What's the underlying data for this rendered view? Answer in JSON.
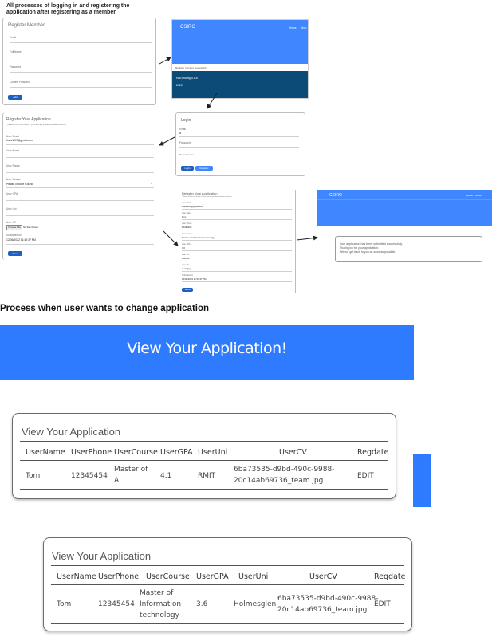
{
  "top_caption": [
    "All processes of logging in and registering the",
    "application after registering as a member"
  ],
  "section_title": "Process when user wants to change application",
  "register_member": {
    "title": "Register Member",
    "fields": [
      "Email",
      "Full Name",
      "Password",
      "Confirm Password"
    ],
    "button": "Add"
  },
  "csiro_home": {
    "brand": "CSIRO",
    "nav": [
      "Home",
      "Abou"
    ],
    "message": "Register member successful!",
    "footer_name": "Hao Hoang D11K",
    "footer_year": "2022"
  },
  "login": {
    "title": "Login",
    "email_label": "Email",
    "email_value": "a",
    "password_label": "Password",
    "remember": "Remember me",
    "login_button": "Login",
    "register_button": "Register"
  },
  "register_application_empty": {
    "title": "Register Your Application",
    "subtitle": "* please fill the form below, if you have any problems please contact us",
    "email_label": "User Email",
    "email_value": "thanhk99@gmail.com",
    "fields": [
      "User Name",
      "User Phone",
      "User Course",
      "User GPA",
      "User Uni",
      "User CV"
    ],
    "course_value": "Please choose Course",
    "file_button": "Choose File",
    "file_text": "No file chosen",
    "date_label": "Submitted on",
    "date_value": "12/06/2022 11:40:37 PM",
    "button": "Send"
  },
  "register_application_filled": {
    "title": "Register Your Application",
    "subtitle": "* please fill the form below, if you have any problems please contact us",
    "fields": [
      {
        "label": "User Email",
        "value": "thanhk99@gmail.com"
      },
      {
        "label": "User Name",
        "value": "Tom"
      },
      {
        "label": "User Phone",
        "value": "12345454"
      },
      {
        "label": "User Course",
        "value": "Master of Information technology"
      },
      {
        "label": "User GPA",
        "value": "3.6"
      },
      {
        "label": "User Uni",
        "value": "Holmes"
      },
      {
        "label": "User CV",
        "value": "team.jpg"
      },
      {
        "label": "Submitted on",
        "value": "12/06/2022 11:54:37 PM"
      }
    ],
    "file_button": "Choose File",
    "button": "Send"
  },
  "csiro_submitted": {
    "brand": "CSIRO",
    "nav": [
      "Home",
      "About"
    ],
    "lines": [
      "Your application has been submitted successfully.",
      "Thank you for your application.",
      "We will get back to you as soon as possible."
    ]
  },
  "view_banner": "View Your Application!",
  "table_one": {
    "title": "View Your Application",
    "headers": [
      "UserName",
      "UserPhone",
      "UserCourse",
      "UserGPA",
      "UserUni",
      "UserCV",
      "Regdate"
    ],
    "row": {
      "name": "Tom",
      "phone": "12345454",
      "course": [
        "Master of",
        "AI"
      ],
      "gpa": "4.1",
      "uni": "RMIT",
      "cv": [
        "6ba73535-d9bd-490c-9988-",
        "20c14ab69736_team.jpg"
      ],
      "action": "EDIT"
    }
  },
  "table_two": {
    "title": "View Your Application",
    "headers": [
      "UserName",
      "UserPhone",
      "UserCourse",
      "UserGPA",
      "UserUni",
      "UserCV",
      "Regdate"
    ],
    "row": {
      "name": "Tom",
      "phone": "12345454",
      "course": [
        "Master of",
        "Information",
        "technology"
      ],
      "gpa": "3.6",
      "uni": "Holmesglen",
      "cv": [
        "6ba73535-d9bd-490c-9988-",
        "20c14ab69736_team.jpg"
      ],
      "action": "EDIT"
    }
  },
  "colors": {
    "banner_blue": "#2f7bff",
    "csiro_blue": "#3f86ff",
    "csiro_footer": "#0c4a78",
    "button_blue": "#1f5fbf"
  }
}
